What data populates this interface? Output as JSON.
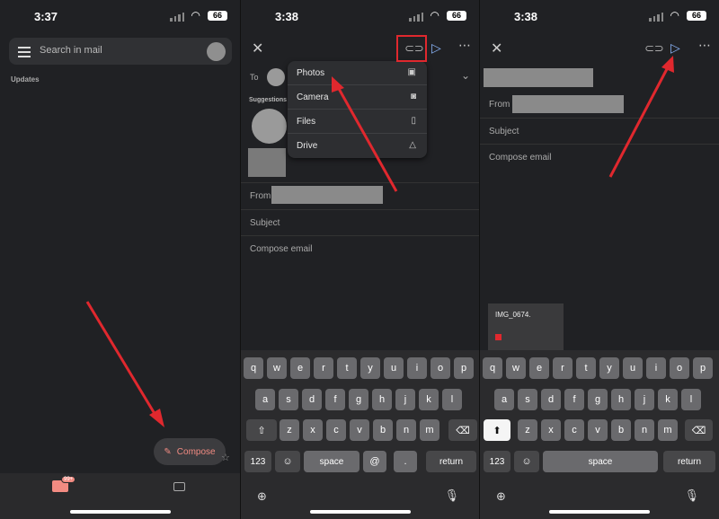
{
  "panel1": {
    "time": "3:37",
    "battery": "66",
    "search_placeholder": "Search in mail",
    "section_label": "Updates",
    "compose_label": "Compose",
    "mail_badge": "99+"
  },
  "panel2": {
    "time": "3:38",
    "battery": "66",
    "to_label": "To",
    "suggestions_label": "Suggestions",
    "from_label": "From",
    "subject_placeholder": "Subject",
    "body_placeholder": "Compose email",
    "attach_menu": [
      {
        "label": "Photos",
        "icon": "photos-icon"
      },
      {
        "label": "Camera",
        "icon": "camera-icon"
      },
      {
        "label": "Files",
        "icon": "file-icon"
      },
      {
        "label": "Drive",
        "icon": "drive-icon"
      }
    ]
  },
  "panel3": {
    "time": "3:38",
    "battery": "66",
    "from_label": "From",
    "subject_placeholder": "Subject",
    "body_placeholder": "Compose email",
    "attachment_name": "IMG_0674."
  },
  "keyboard": {
    "row1": [
      "q",
      "w",
      "e",
      "r",
      "t",
      "y",
      "u",
      "i",
      "o",
      "p"
    ],
    "row2": [
      "a",
      "s",
      "d",
      "f",
      "g",
      "h",
      "j",
      "k",
      "l"
    ],
    "row3": [
      "z",
      "x",
      "c",
      "v",
      "b",
      "n",
      "m"
    ],
    "numbers_key": "123",
    "space_key": "space",
    "return_key": "return",
    "at_key": "@",
    "dot_key": "."
  },
  "colors": {
    "accent_red": "#e0282e",
    "send_blue": "#8ab4f8",
    "compose_pink": "#f28b82"
  }
}
